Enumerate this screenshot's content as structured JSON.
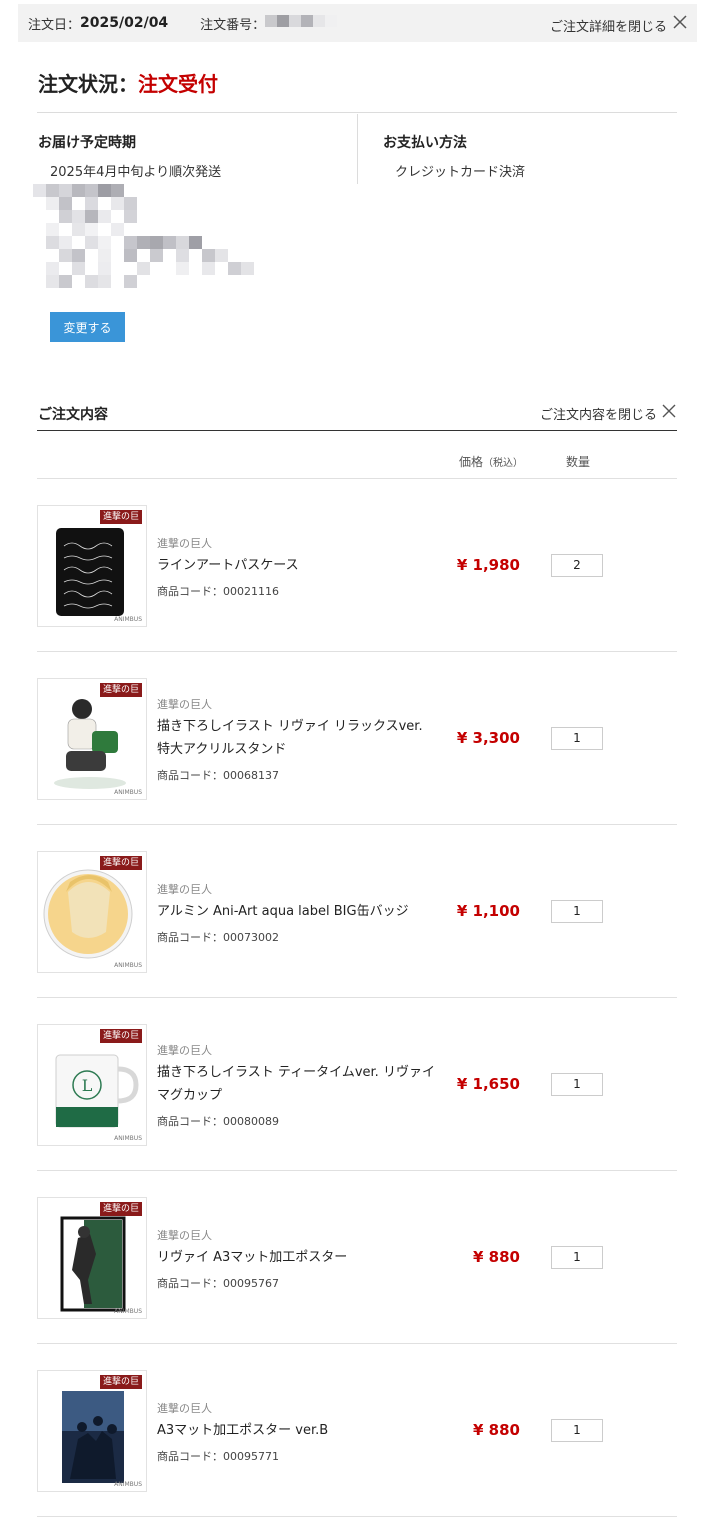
{
  "header": {
    "order_date_label": "注文日：",
    "order_date": "2025/02/04",
    "order_number_label": "注文番号：",
    "close_details_label": "ご注文詳細を閉じる"
  },
  "status": {
    "label": "注文状況：",
    "value": "注文受付"
  },
  "delivery": {
    "heading": "お届け予定時期",
    "value": "2025年4月中旬より順次発送"
  },
  "payment": {
    "heading": "お支払い方法",
    "value": "クレジットカード決済"
  },
  "change_button": "変更する",
  "order_contents": {
    "title": "ご注文内容",
    "close_label": "ご注文内容を閉じる",
    "col_price": "価格",
    "col_price_note": "（税込）",
    "col_qty": "数量"
  },
  "items": [
    {
      "series": "進撃の巨人",
      "name": "ラインアートパスケース",
      "code": "商品コード：00021116",
      "price": "¥ 1,980",
      "qty": "2"
    },
    {
      "series": "進撃の巨人",
      "name": "描き下ろしイラスト リヴァイ リラックスver. 特大アクリルスタンド",
      "code": "商品コード：00068137",
      "price": "¥ 3,300",
      "qty": "1"
    },
    {
      "series": "進撃の巨人",
      "name": "アルミン Ani-Art aqua label BIG缶バッジ",
      "code": "商品コード：00073002",
      "price": "¥ 1,100",
      "qty": "1"
    },
    {
      "series": "進撃の巨人",
      "name": "描き下ろしイラスト ティータイムver. リヴァイ マグカップ",
      "code": "商品コード：00080089",
      "price": "¥ 1,650",
      "qty": "1"
    },
    {
      "series": "進撃の巨人",
      "name": "リヴァイ A3マット加工ポスター",
      "code": "商品コード：00095767",
      "price": "¥ 880",
      "qty": "1"
    },
    {
      "series": "進撃の巨人",
      "name": "A3マット加工ポスター ver.B",
      "code": "商品コード：00095771",
      "price": "¥ 880",
      "qty": "1"
    }
  ],
  "colors": {
    "accent_red": "#c40000",
    "button_blue": "#3a95d8",
    "topbar_bg": "#f2f2f2"
  },
  "icons": [
    "close-icon"
  ]
}
